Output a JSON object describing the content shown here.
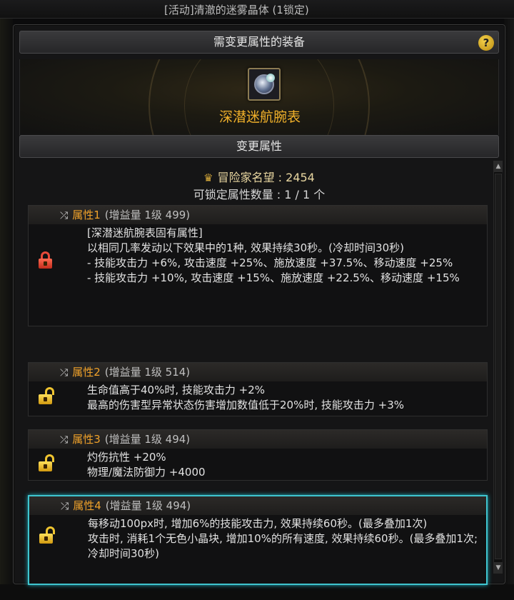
{
  "window": {
    "title": "[活动]清澈的迷雾晶体 (1锁定)"
  },
  "equipment_section": {
    "header": "需变更属性的装备",
    "help_label": "?",
    "item_name": "深潜迷航腕表"
  },
  "change_section": {
    "header": "变更属性",
    "reputation_label": "冒险家名望 : 2454",
    "lock_count_label": "可锁定属性数量 :   1 / 1 个"
  },
  "attributes": [
    {
      "label": "属性1",
      "meta": "(增益量 1级 499)",
      "locked": true,
      "lines": [
        "[深潜迷航腕表固有属性]",
        "以相同几率发动以下效果中的1种, 效果持续30秒。(冷却时间30秒)",
        "- 技能攻击力 +6%, 攻击速度 +25%、施放速度 +37.5%、移动速度 +25%",
        "- 技能攻击力 +10%, 攻击速度 +15%、施放速度 +22.5%、移动速度 +15%"
      ]
    },
    {
      "label": "属性2",
      "meta": "(增益量 1级 514)",
      "locked": false,
      "lines": [
        "生命值高于40%时, 技能攻击力 +2%",
        "最高的伤害型异常状态伤害增加数值低于20%时, 技能攻击力 +3%"
      ]
    },
    {
      "label": "属性3",
      "meta": "(增益量 1级 494)",
      "locked": false,
      "lines": [
        "灼伤抗性 +20%",
        "物理/魔法防御力 +4000"
      ]
    },
    {
      "label": "属性4",
      "meta": "(增益量 1级 494)",
      "locked": false,
      "selected": true,
      "lines": [
        "每移动100px时, 增加6%的技能攻击力, 效果持续60秒。(最多叠加1次)",
        "攻击时, 消耗1个无色小晶块, 增加10%的所有速度, 效果持续60秒。(最多叠加1次; 冷却时间30秒)"
      ]
    }
  ],
  "icons": {
    "shuffle": "shuffle-icon",
    "lock_locked": "lock-closed-icon",
    "lock_unlocked": "lock-open-icon",
    "reputation": "reputation-emblem-icon"
  },
  "colors": {
    "attr_label": "#f0a22a",
    "item_name": "#f0b02a",
    "selected_border": "#3fc5cf",
    "locked_icon": "#e84a3a",
    "unlocked_icon": "#f0c530"
  }
}
